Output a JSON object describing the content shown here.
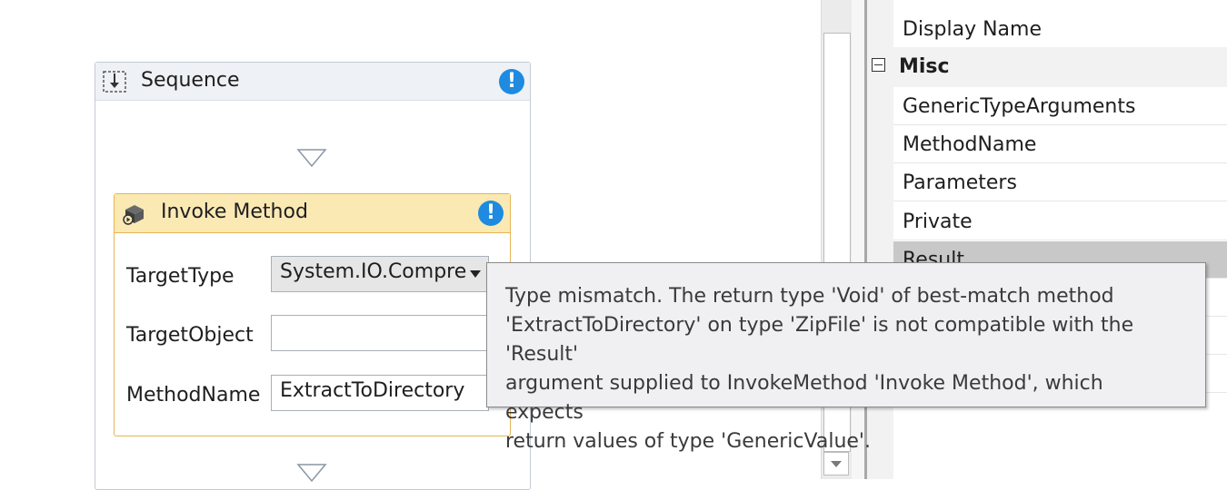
{
  "designer": {
    "sequence": {
      "title": "Sequence",
      "icon": "sequence-icon",
      "warning_icon": "warning-info-icon"
    },
    "invoke_method": {
      "title": "Invoke Method",
      "icon": "invoke-method-icon",
      "warning_icon": "warning-info-icon",
      "fields": {
        "target_type_label": "TargetType",
        "target_type_value": "System.IO.Compre",
        "target_object_label": "TargetObject",
        "target_object_value": "",
        "method_name_label": "MethodName",
        "method_name_value": "ExtractToDirectory"
      }
    },
    "tooltip": "Type mismatch. The return type 'Void' of best-match method\n'ExtractToDirectory' on type 'ZipFile' is not compatible with the 'Result'\nargument supplied to InvokeMethod 'Invoke Method', which expects\nreturn values of type 'GenericValue'."
  },
  "properties": {
    "rows_top": [
      "Display Name"
    ],
    "category": "Misc",
    "rows": [
      "GenericTypeArguments",
      "MethodName",
      "Parameters",
      "Private",
      "Result"
    ],
    "selected": "Result"
  },
  "colors": {
    "warning_blue": "#1e8be0",
    "invoke_header": "#fbe9b4",
    "invoke_border": "#e5b554",
    "sequence_header": "#eef1f5",
    "selected_row": "#c8c8c8"
  }
}
